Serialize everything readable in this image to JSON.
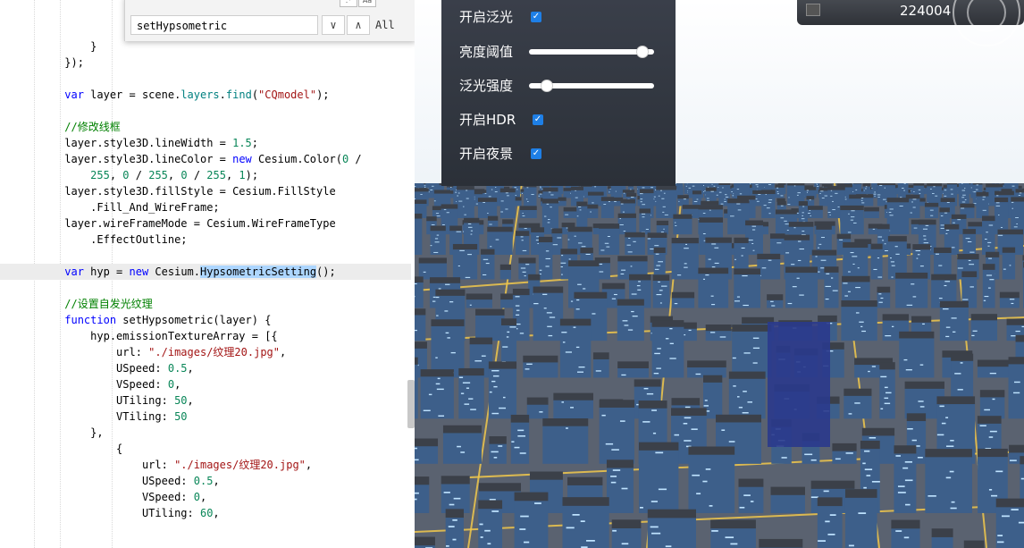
{
  "find_widget": {
    "query": "setHypsometric",
    "count": "All",
    "prev_label": "∨",
    "next_label": "∧",
    "opt_case": "Aa",
    "opt_regex": ".*"
  },
  "code": [
    {
      "text": "            }"
    },
    {
      "text": "        });"
    },
    {
      "text": ""
    },
    {
      "text": "        var layer = scene.layers.find(\"CQmodel\");"
    },
    {
      "text": ""
    },
    {
      "text": "        //修改线框"
    },
    {
      "text": "        layer.style3D.lineWidth = 1.5;"
    },
    {
      "text": "        layer.style3D.lineColor = new Cesium.Color(0 /"
    },
    {
      "text": "            255, 0 / 255, 0 / 255, 1);"
    },
    {
      "text": "        layer.style3D.fillStyle = Cesium.FillStyle"
    },
    {
      "text": "            .Fill_And_WireFrame;"
    },
    {
      "text": "        layer.wireFrameMode = Cesium.WireFrameType"
    },
    {
      "text": "            .EffectOutline;"
    },
    {
      "text": ""
    },
    {
      "text": "        var hyp = new Cesium.HypsometricSetting();"
    },
    {
      "text": ""
    },
    {
      "text": "        //设置自发光纹理"
    },
    {
      "text": "        function setHypsometric(layer) {"
    },
    {
      "text": "            hyp.emissionTextureArray = [{"
    },
    {
      "text": "                url: \"./images/纹理20.jpg\","
    },
    {
      "text": "                USpeed: 0.5,"
    },
    {
      "text": "                VSpeed: 0,"
    },
    {
      "text": "                UTiling: 50,"
    },
    {
      "text": "                VTiling: 50"
    },
    {
      "text": "            },"
    },
    {
      "text": "                {"
    },
    {
      "text": "                    url: \"./images/纹理20.jpg\","
    },
    {
      "text": "                    USpeed: 0.5,"
    },
    {
      "text": "                    VSpeed: 0,"
    },
    {
      "text": "                    UTiling: 60,"
    }
  ],
  "panel": {
    "bloom_label": "开启泛光",
    "bloom_checked": true,
    "brightness_label": "亮度阈值",
    "brightness_value": 0.95,
    "bloom_intensity_label": "泛光强度",
    "bloom_intensity_value": 0.1,
    "hdr_label": "开启HDR",
    "hdr_checked": true,
    "night_label": "开启夜景",
    "night_checked": true
  },
  "status": {
    "value": "224004"
  },
  "colors": {
    "keyword": "#0000ff",
    "string": "#a31515",
    "number": "#098658",
    "comment": "#008000",
    "checkbox": "#1e7fe6",
    "building": "#3d5f8a",
    "road_glow": "#f2c94c"
  }
}
